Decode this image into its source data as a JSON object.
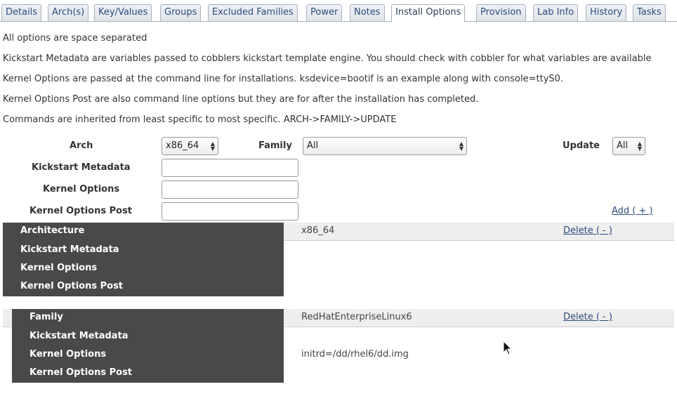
{
  "tabs": [
    {
      "label": "Details"
    },
    {
      "label": "Arch(s)"
    },
    {
      "label": "Key/Values"
    },
    {
      "label": "Groups"
    },
    {
      "label": "Excluded Families"
    },
    {
      "label": "Power"
    },
    {
      "label": "Notes"
    },
    {
      "label": "Install Options",
      "active": true
    },
    {
      "label": "Provision"
    },
    {
      "label": "Lab Info"
    },
    {
      "label": "History"
    },
    {
      "label": "Tasks"
    }
  ],
  "notes": [
    "All options are space separated",
    "Kickstart Metadata are variables passed to cobblers kickstart template engine. You should check with cobbler for what variables are available",
    "Kernel Options are passed at the command line for installations. ksdevice=bootif is an example along with console=ttyS0.",
    "Kernel Options Post are also command line options but they are for after the installation has completed.",
    "Commands are inherited from least specific to most specific. ARCH->FAMILY->UPDATE"
  ],
  "form": {
    "arch_label": "Arch",
    "arch_value": "x86_64",
    "family_label": "Family",
    "family_value": "All",
    "update_label": "Update",
    "update_value": "All",
    "ks_meta_label": "Kickstart Metadata",
    "ks_meta_value": "",
    "kernel_options_label": "Kernel Options",
    "kernel_options_value": "",
    "kernel_options_post_label": "Kernel Options Post",
    "kernel_options_post_value": "",
    "add_link": "Add ( + )"
  },
  "sections": {
    "arch": {
      "header": "Architecture",
      "value": "x86_64",
      "delete_link": "Delete ( - )",
      "rows": [
        {
          "label": "Kickstart Metadata",
          "value": ""
        },
        {
          "label": "Kernel Options",
          "value": ""
        },
        {
          "label": "Kernel Options Post",
          "value": ""
        }
      ]
    },
    "family": {
      "header": "Family",
      "value": "RedHatEnterpriseLinux6",
      "delete_link": "Delete ( - )",
      "rows": [
        {
          "label": "Kickstart Metadata",
          "value": ""
        },
        {
          "label": "Kernel Options",
          "value": "initrd=/dd/rhel6/dd.img"
        },
        {
          "label": "Kernel Options Post",
          "value": ""
        }
      ]
    }
  },
  "icons": {
    "select_arrows": "updown-arrows-icon",
    "cursor": "mouse-pointer-icon"
  }
}
